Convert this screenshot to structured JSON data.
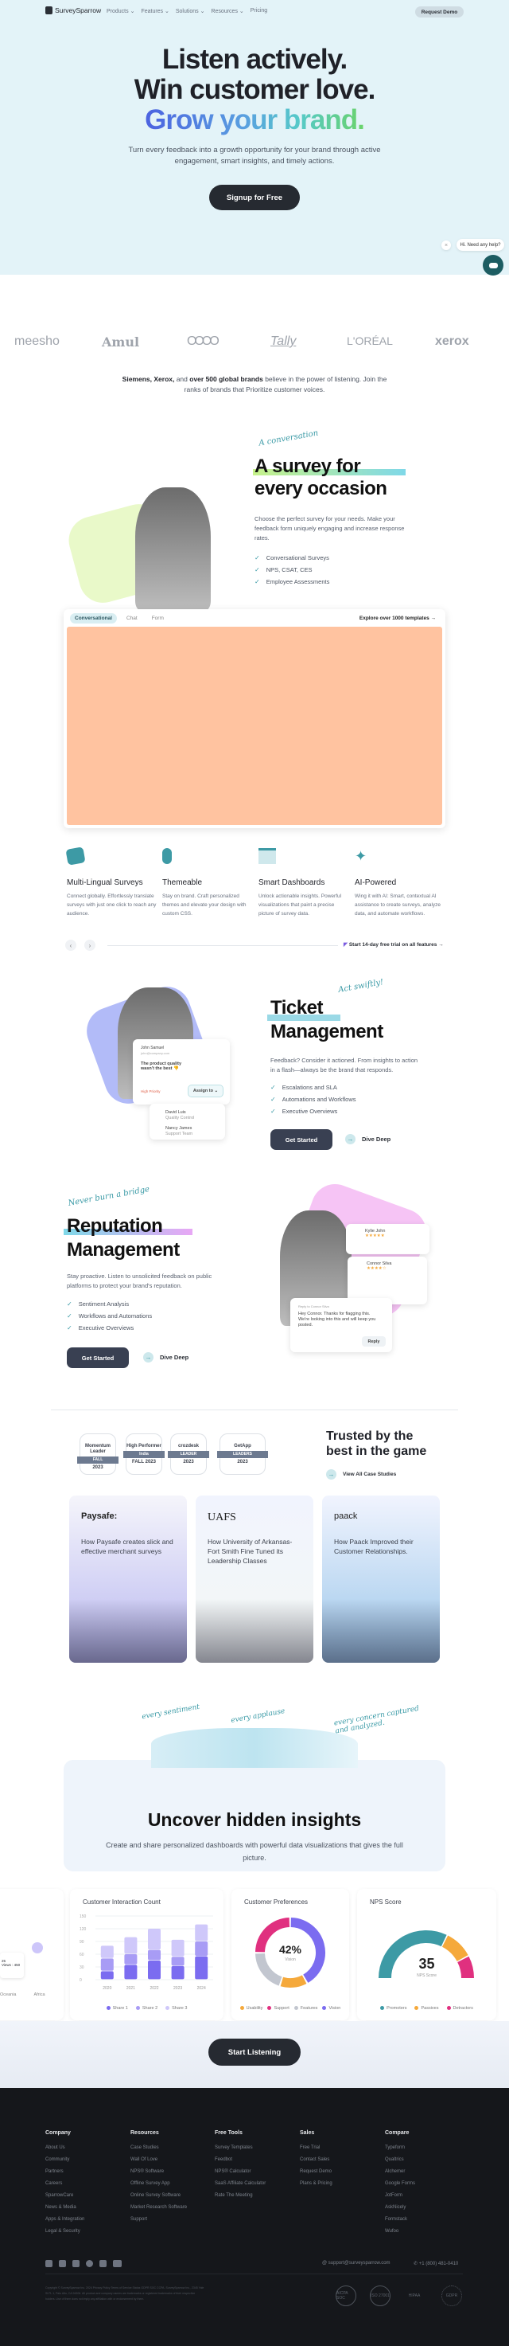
{
  "nav": {
    "brand": "SurveySparrow",
    "menu": [
      "Products ⌄",
      "Features ⌄",
      "Solutions ⌄",
      "Resources ⌄",
      "Pricing"
    ],
    "request_demo": "Request Demo"
  },
  "hero": {
    "line1": "Listen actively.",
    "line2": "Win customer love.",
    "line3": "Grow your brand.",
    "subtitle": "Turn every feedback into a growth opportunity for your brand through active engagement, smart insights, and timely actions.",
    "cta": "Signup for Free"
  },
  "chat_widget": {
    "close": "×",
    "message": "Hi. Need any help?"
  },
  "logos": [
    "meesho",
    "Amul",
    "OOOO",
    "Tally",
    "L'ORÉAL",
    "xerox"
  ],
  "brands_text": {
    "bold1": "Siemens, Xerox,",
    "mid": " and ",
    "bold2": "over 500 global brands",
    "rest": " believe in the power of listening. Join the ranks of brands that Prioritize customer voices."
  },
  "survey_section": {
    "handwritten": "A conversation",
    "title_line1": "A survey for",
    "title_line2": "every occasion",
    "description": "Choose the perfect survey for your needs. Make your feedback form uniquely engaging and increase response rates.",
    "checks": [
      "Conversational Surveys",
      "NPS, CSAT, CES",
      "Employee Assessments"
    ]
  },
  "template_panel": {
    "tabs": [
      "Conversational",
      "Chat",
      "Form"
    ],
    "active_tab": "Conversational",
    "explore": "Explore over 1000 templates →"
  },
  "features": [
    {
      "title": "Multi-Lingual Surveys",
      "text": "Connect globally. Effortlessly translate surveys with just one click to reach any audience.",
      "icon": "translate-icon"
    },
    {
      "title": "Themeable",
      "text": "Stay on brand. Craft personalized themes and elevate your design with custom CSS.",
      "icon": "palette-icon"
    },
    {
      "title": "Smart Dashboards",
      "text": "Unlock actionable insights. Powerful visualizations that paint a precise picture of survey data.",
      "icon": "dashboard-icon"
    },
    {
      "title": "AI-Powered",
      "text": "Wing it with AI: Smart, contextual AI assistance to create surveys, analyze data, and automate workflows.",
      "icon": "sparkle-feather-icon"
    }
  ],
  "carousel": {
    "prev": "‹",
    "next": "›",
    "trial": "Start 14-day free trial on all features →"
  },
  "ticket": {
    "handwritten": "Act swiftly!",
    "title_line1": "Ticket",
    "title_line2": "Management",
    "description": "Feedback? Consider it actioned. From insights to action in a flash—always be the brand that responds.",
    "checks": [
      "Escalations and SLA",
      "Automations and Workflows",
      "Executive Overviews"
    ],
    "get_started": "Get Started",
    "dive_deep": "Dive Deep",
    "card": {
      "name": "John Samuel",
      "email": "john@company.com",
      "message": "The product quality wasn't the best 👎",
      "priority": "High Priority",
      "assign": "Assign to ⌄",
      "assignees": [
        {
          "name": "David Luis",
          "team": "Quality Control"
        },
        {
          "name": "Nancy James",
          "team": "Support Team"
        }
      ]
    }
  },
  "reputation": {
    "handwritten": "Never burn a bridge",
    "title_line1": "Reputation",
    "title_line2": "Management",
    "description": "Stay proactive. Listen to unsolicited feedback on public platforms to protect your brand's reputation.",
    "checks": [
      "Sentiment Analysis",
      "Workflows and Automations",
      "Executive Overviews"
    ],
    "get_started": "Get Started",
    "dive_deep": "Dive Deep",
    "reviews": [
      {
        "name": "Kylie John",
        "stars": "★★★★★"
      },
      {
        "name": "Connor Silva",
        "stars": "★★★★☆"
      }
    ],
    "reply_card": {
      "header": "Reply to Connor Silva",
      "text": "Hey Connor. Thanks for flagging this. We're looking into this and will keep you posted.",
      "button": "Reply"
    }
  },
  "trusted": {
    "badges": [
      {
        "top": "Momentum Leader",
        "strip": "FALL",
        "bottom": "2023"
      },
      {
        "top": "High Performer",
        "strip": "India",
        "bottom": "FALL 2023"
      },
      {
        "top": "crozdesk",
        "strip": "LEADER",
        "bottom": "2023"
      },
      {
        "top": "GetApp",
        "strip": "LEADERS",
        "bottom": "2023"
      }
    ],
    "title_line1": "Trusted by the",
    "title_line2": "best in the game",
    "view_all": "View All Case Studies"
  },
  "case_studies": [
    {
      "logo": "Paysafe:",
      "text": "How Paysafe creates slick and effective merchant surveys"
    },
    {
      "logo": "UAFS",
      "text": "How University of Arkansas-Fort Smith Fine Tuned its Leadership Classes"
    },
    {
      "logo": "paack",
      "text": "How Paack Improved their Customer Relationships."
    }
  ],
  "sentiments": [
    "every sentiment",
    "every applause",
    "every concern captured and analyzed."
  ],
  "insights": {
    "title": "Uncover hidden insights",
    "subtitle": "Create and share personalized dashboards with powerful data visualizations that gives the full picture.",
    "cta": "Start Listening"
  },
  "left_partial_card": {
    "labels": [
      "Oceania",
      "Africa"
    ],
    "tooltip": [
      "25",
      "Views : 450"
    ]
  },
  "chart_data": [
    {
      "type": "bar",
      "title": "Customer Interaction Count",
      "categories": [
        "2020",
        "2021",
        "2022",
        "2023",
        "2024"
      ],
      "series": [
        {
          "name": "Share 1",
          "values": [
            20,
            35,
            45,
            32,
            55
          ]
        },
        {
          "name": "Share 2",
          "values": [
            30,
            25,
            25,
            22,
            35
          ]
        },
        {
          "name": "Share 3",
          "values": [
            30,
            40,
            50,
            40,
            40
          ]
        }
      ],
      "ylim": [
        0,
        150
      ],
      "yticks": [
        0,
        30,
        60,
        90,
        120,
        150
      ],
      "colors": [
        "#7b6cf0",
        "#a89cf5",
        "#cfc8fa"
      ],
      "legend": "bottom"
    },
    {
      "type": "pie",
      "title": "Customer Preferences",
      "categories": [
        "Usability",
        "Support",
        "Features",
        "Vision"
      ],
      "values": [
        13,
        25,
        20,
        42
      ],
      "center_value": "42%",
      "center_label": "Vision",
      "colors": [
        "#f5a93b",
        "#e0307f",
        "#c2c6cf",
        "#7b6cf0"
      ],
      "legend": "bottom"
    },
    {
      "type": "pie",
      "title": "NPS Score",
      "categories": [
        "Promoters",
        "Passives",
        "Detractors"
      ],
      "values": [
        65,
        20,
        15
      ],
      "center_value": "35",
      "center_label": "NPS Score",
      "colors": [
        "#3d9aa5",
        "#f5a93b",
        "#e0307f"
      ],
      "legend": "bottom"
    }
  ],
  "footer": {
    "columns": [
      {
        "title": "Company",
        "links": [
          "About Us",
          "Community",
          "Partners",
          "Careers",
          "SparrowCare",
          "News & Media",
          "Apps & Integration",
          "Legal & Security"
        ]
      },
      {
        "title": "Resources",
        "links": [
          "Case Studies",
          "Wall Of Love",
          "NPS® Software",
          "Offline Survey App",
          "Online Survey Software",
          "Market Research Software",
          "Support"
        ]
      },
      {
        "title": "Free Tools",
        "links": [
          "Survey Templates",
          "Feedbot",
          "NPS® Calculator",
          "SaaS Affiliate Calculator",
          "Rate The Meeting"
        ]
      },
      {
        "title": "Sales",
        "links": [
          "Free Trial",
          "Contact Sales",
          "Request Demo",
          "Plans & Pricing"
        ]
      },
      {
        "title": "Compare",
        "links": [
          "Typeform",
          "Qualtrics",
          "Alchemer",
          "Google Forms",
          "JotForm",
          "AskNicely",
          "Formstack",
          "Wufoo"
        ]
      }
    ],
    "email": "support@surveysparrow.com",
    "phone": "+1 (800) 481-0410",
    "copyright": "Copyright © SurveySparrow Inc. 2024 Privacy Policy Terms of Service Status GDPR SOC CCPA. SurveySparrow Inc., 2345 Yale St FL 1, Palo Alto, CA 94306. All product and company names are trademarks or registered trademarks of their respective holders. Use of them does not imply any affiliation with or endorsement by them.",
    "certs": [
      "AICPA SOC",
      "ISO 27001",
      "HIPAA",
      "GDPR"
    ]
  }
}
